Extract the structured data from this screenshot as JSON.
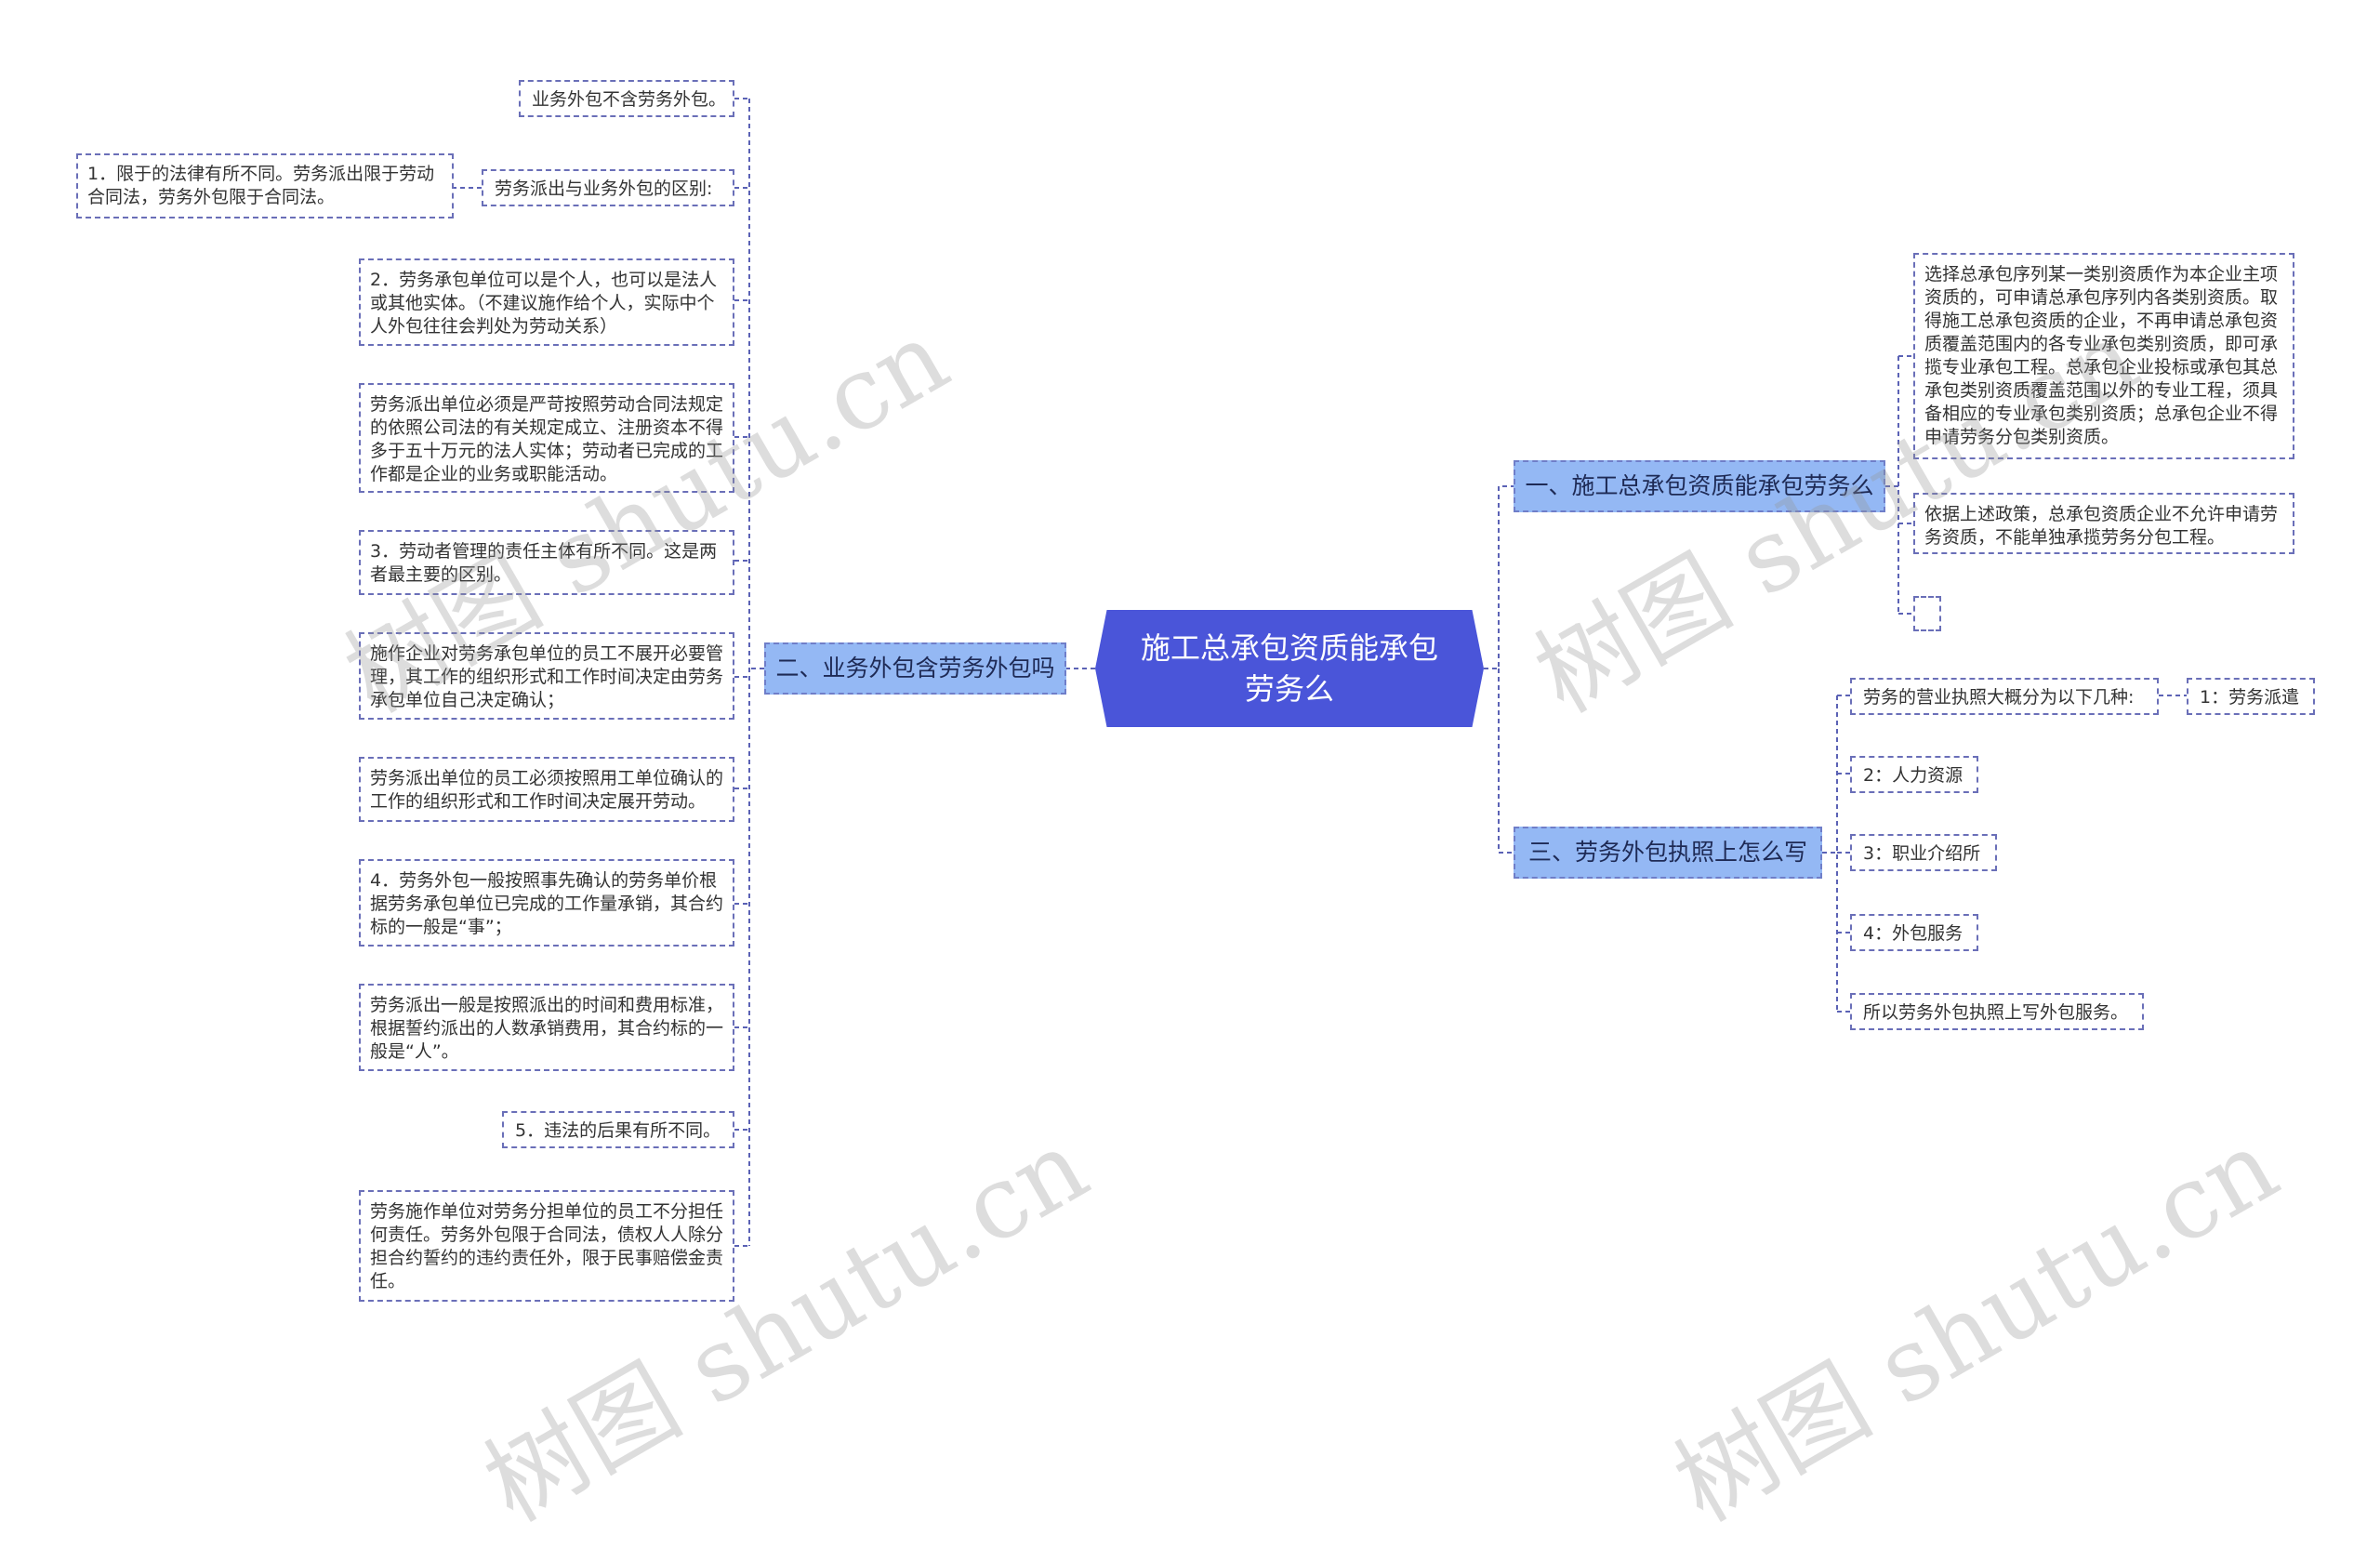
{
  "root": {
    "title": "施工总承包资质能承包劳务么"
  },
  "branches": {
    "b1": {
      "label": "一、施工总承包资质能承包劳务么"
    },
    "b2": {
      "label": "二、业务外包含劳务外包吗"
    },
    "b3": {
      "label": "三、劳务外包执照上怎么写"
    }
  },
  "b1_children": [
    "选择总承包序列某一类别资质作为本企业主项资质的，可申请总承包序列内各类别资质。取得施工总承包资质的企业，不再申请总承包资质覆盖范围内的各专业承包类别资质，即可承揽专业承包工程。总承包企业投标或承包其总承包类别资质覆盖范围以外的专业工程，须具备相应的专业承包类别资质；总承包企业不得申请劳务分包类别资质。",
    "依据上述政策，总承包资质企业不允许申请劳务资质，不能单独承揽劳务分包工程。",
    ""
  ],
  "b2_children": [
    "业务外包不含劳务外包。",
    "劳务派出与业务外包的区别:",
    "2．劳务承包单位可以是个人，也可以是法人或其他实体。（不建议施作给个人，实际中个人外包往往会判处为劳动关系）",
    "劳务派出单位必须是严苛按照劳动合同法规定的依照公司法的有关规定成立、注册资本不得多于五十万元的法人实体；劳动者已完成的工作都是企业的业务或职能活动。",
    "3．劳动者管理的责任主体有所不同。这是两者最主要的区别。",
    "施作企业对劳务承包单位的员工不展开必要管理，其工作的组织形式和工作时间决定由劳务承包单位自己决定确认；",
    "劳务派出单位的员工必须按照用工单位确认的工作的组织形式和工作时间决定展开劳动。",
    "4．劳务外包一般按照事先确认的劳务单价根据劳务承包单位已完成的工作量承销，其合约标的一般是“事”；",
    "劳务派出一般是按照派出的时间和费用标准，根据誓约派出的人数承销费用，其合约标的一般是“人”。",
    "5．违法的后果有所不同。",
    "劳务施作单位对劳务分担单位的员工不分担任何责任。劳务外包限于合同法，债权人人除分担合约誓约的违约责任外，限于民事赔偿金责任。"
  ],
  "b2_sub": "1．限于的法律有所不同。劳务派出限于劳动合同法，劳务外包限于合同法。",
  "b3_children": [
    "劳务的营业执照大概分为以下几种:",
    "2：人力资源",
    "3：职业介绍所",
    "4：外包服务",
    "所以劳务外包执照上写外包服务。"
  ],
  "b3_sub": "1：劳务派遣",
  "watermarks": [
    "树图 shutu.cn",
    "树图 shutu.cn",
    "树图 shutu.cn",
    "树图 shutu.cn"
  ],
  "colors": {
    "root": "#4a55d9",
    "branch": "#94b8f4",
    "line": "#5b62b5"
  }
}
